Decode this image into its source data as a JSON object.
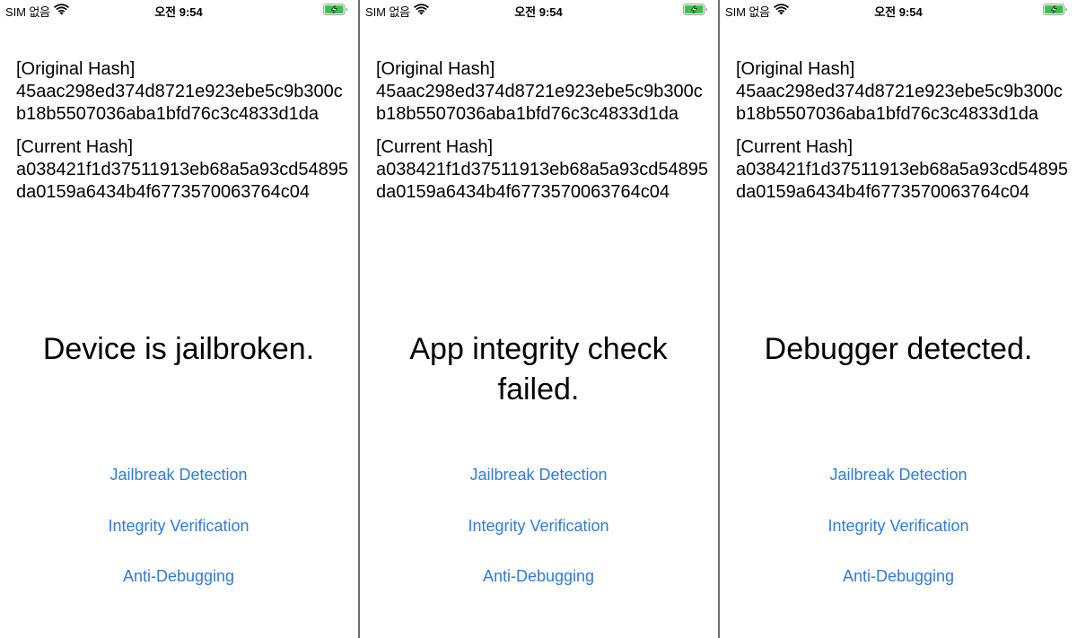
{
  "status_bar": {
    "carrier": "SIM 없음",
    "time": "오전 9:54",
    "wifi_icon": "wifi-icon",
    "battery_icon": "battery-charging-icon",
    "battery_color": "#3cc24a"
  },
  "colors": {
    "button_text": "#2f7bd9",
    "divider": "#6e6e6e"
  },
  "screens": [
    {
      "original_hash_label": "[Original Hash]",
      "original_hash": "45aac298ed374d8721e923ebe5c9b300cb18b5507036aba1bfd76c3c4833d1da",
      "current_hash_label": "[Current Hash]",
      "current_hash": "a038421f1d37511913eb68a5a93cd54895da0159a6434b4f6773570063764c04",
      "result_message": "Device is jailbroken.",
      "buttons": [
        "Jailbreak Detection",
        "Integrity Verification",
        "Anti-Debugging"
      ]
    },
    {
      "original_hash_label": "[Original Hash]",
      "original_hash": "45aac298ed374d8721e923ebe5c9b300cb18b5507036aba1bfd76c3c4833d1da",
      "current_hash_label": "[Current Hash]",
      "current_hash": "a038421f1d37511913eb68a5a93cd54895da0159a6434b4f6773570063764c04",
      "result_message": "App integrity check failed.",
      "buttons": [
        "Jailbreak Detection",
        "Integrity Verification",
        "Anti-Debugging"
      ]
    },
    {
      "original_hash_label": "[Original Hash]",
      "original_hash": "45aac298ed374d8721e923ebe5c9b300cb18b5507036aba1bfd76c3c4833d1da",
      "current_hash_label": "[Current Hash]",
      "current_hash": "a038421f1d37511913eb68a5a93cd54895da0159a6434b4f6773570063764c04",
      "result_message": "Debugger detected.",
      "buttons": [
        "Jailbreak Detection",
        "Integrity Verification",
        "Anti-Debugging"
      ]
    }
  ]
}
